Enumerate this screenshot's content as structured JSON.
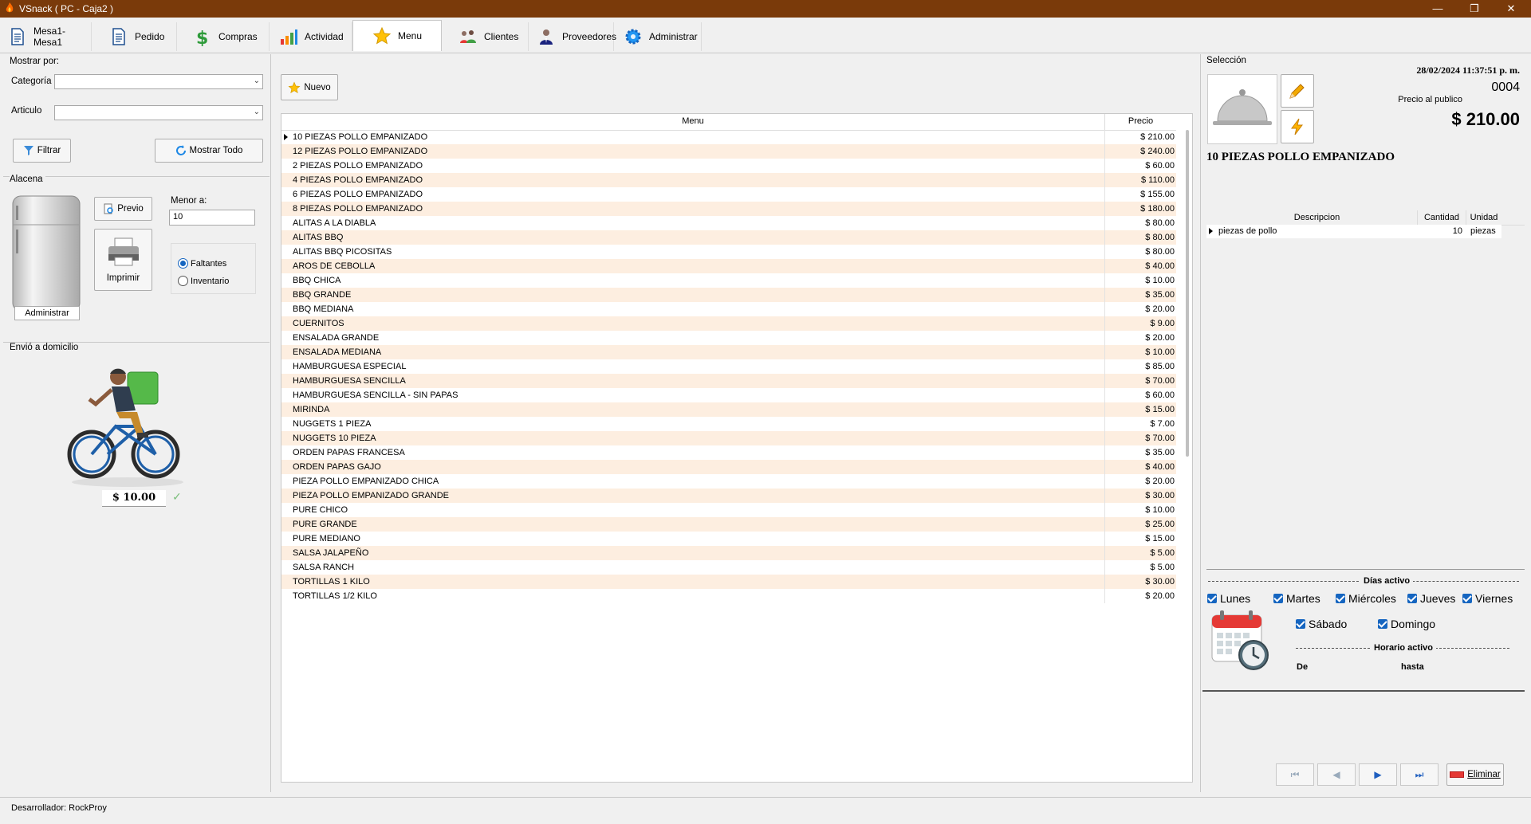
{
  "window": {
    "title": "VSnack ( PC - Caja2 )"
  },
  "tabs": [
    {
      "label": "Mesa1-Mesa1",
      "icon": "document-icon"
    },
    {
      "label": "Pedido",
      "icon": "document-icon"
    },
    {
      "label": "Compras",
      "icon": "dollar-icon"
    },
    {
      "label": "Actividad",
      "icon": "bar-chart-icon"
    },
    {
      "label": "Menu",
      "icon": "star-icon",
      "active": true
    },
    {
      "label": "Clientes",
      "icon": "people-icon"
    },
    {
      "label": "Proveedores",
      "icon": "person-icon"
    },
    {
      "label": "Administrar",
      "icon": "gear-icon"
    }
  ],
  "filters": {
    "section_title": "Mostrar por:",
    "category_label": "Categoría",
    "category_value": "",
    "article_label": "Articulo",
    "article_value": "",
    "filter_button": "Filtrar",
    "show_all_button": "Mostrar Todo"
  },
  "pantry": {
    "section_title": "Alacena",
    "admin_label": "Administrar",
    "preview_button": "Previo",
    "print_button": "Imprimir",
    "less_than_label": "Menor a:",
    "less_than_value": "10",
    "radio_missing": "Faltantes",
    "radio_inventory": "Inventario"
  },
  "delivery": {
    "section_title": "Envió a domicilio",
    "price": "$ 10.00"
  },
  "menu": {
    "new_button": "Nuevo",
    "columns": {
      "name": "Menu",
      "price": "Precio"
    },
    "items": [
      {
        "name": "10 PIEZAS POLLO EMPANIZADO",
        "price": "$ 210.00"
      },
      {
        "name": "12 PIEZAS POLLO EMPANIZADO",
        "price": "$ 240.00"
      },
      {
        "name": "2 PIEZAS POLLO EMPANIZADO",
        "price": "$ 60.00"
      },
      {
        "name": "4 PIEZAS POLLO EMPANIZADO",
        "price": "$ 110.00"
      },
      {
        "name": "6 PIEZAS POLLO EMPANIZADO",
        "price": "$ 155.00"
      },
      {
        "name": "8 PIEZAS POLLO EMPANIZADO",
        "price": "$ 180.00"
      },
      {
        "name": "ALITAS A LA DIABLA",
        "price": "$ 80.00"
      },
      {
        "name": "ALITAS BBQ",
        "price": "$ 80.00"
      },
      {
        "name": "ALITAS BBQ PICOSITAS",
        "price": "$ 80.00"
      },
      {
        "name": "AROS DE CEBOLLA",
        "price": "$ 40.00"
      },
      {
        "name": "BBQ CHICA",
        "price": "$ 10.00"
      },
      {
        "name": "BBQ GRANDE",
        "price": "$ 35.00"
      },
      {
        "name": "BBQ MEDIANA",
        "price": "$ 20.00"
      },
      {
        "name": "CUERNITOS",
        "price": "$ 9.00"
      },
      {
        "name": "ENSALADA GRANDE",
        "price": "$ 20.00"
      },
      {
        "name": "ENSALADA MEDIANA",
        "price": "$ 10.00"
      },
      {
        "name": "HAMBURGUESA ESPECIAL",
        "price": "$ 85.00"
      },
      {
        "name": "HAMBURGUESA SENCILLA",
        "price": "$ 70.00"
      },
      {
        "name": "HAMBURGUESA SENCILLA - SIN PAPAS",
        "price": "$ 60.00"
      },
      {
        "name": "MIRINDA",
        "price": "$ 15.00"
      },
      {
        "name": "NUGGETS 1 PIEZA",
        "price": "$ 7.00"
      },
      {
        "name": "NUGGETS 10 PIEZA",
        "price": "$ 70.00"
      },
      {
        "name": "ORDEN PAPAS FRANCESA",
        "price": "$ 35.00"
      },
      {
        "name": "ORDEN PAPAS GAJO",
        "price": "$ 40.00"
      },
      {
        "name": "PIEZA POLLO EMPANIZADO CHICA",
        "price": "$ 20.00"
      },
      {
        "name": "PIEZA POLLO EMPANIZADO GRANDE",
        "price": "$ 30.00"
      },
      {
        "name": "PURE CHICO",
        "price": "$ 10.00"
      },
      {
        "name": "PURE GRANDE",
        "price": "$ 25.00"
      },
      {
        "name": "PURE MEDIANO",
        "price": "$ 15.00"
      },
      {
        "name": "SALSA JALAPEÑO",
        "price": "$ 5.00"
      },
      {
        "name": "SALSA RANCH",
        "price": "$ 5.00"
      },
      {
        "name": "TORTILLAS 1 KILO",
        "price": "$ 30.00"
      },
      {
        "name": "TORTILLAS 1/2 KILO",
        "price": "$ 20.00"
      }
    ]
  },
  "selection": {
    "section_title": "Selección",
    "datetime": "28/02/2024 11:37:51 p. m.",
    "code": "0004",
    "price_label": "Precio al publico",
    "price": "$ 210.00",
    "product_name": "10 PIEZAS POLLO EMPANIZADO",
    "ingredients_columns": {
      "description": "Descripcion",
      "quantity": "Cantidad",
      "unit": "Unidad"
    },
    "ingredients": [
      {
        "description": "piezas de pollo",
        "quantity": "10",
        "unit": "piezas"
      }
    ],
    "active_days_title": "Días activo",
    "days": [
      "Lunes",
      "Martes",
      "Miércoles",
      "Jueves",
      "Viernes",
      "Sábado",
      "Domingo"
    ],
    "schedule_title": "Horario activo",
    "from_label": "De",
    "to_label": "hasta",
    "delete_button": "Eliminar"
  },
  "status": {
    "developer": "Desarrollador: RockProy"
  },
  "colors": {
    "titlebar": "#7a3a0a",
    "row_alt": "#fdeee0",
    "accent": "#1565c0"
  }
}
